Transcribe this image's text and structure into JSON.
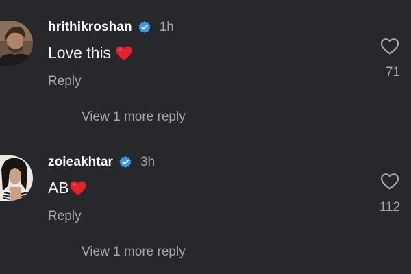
{
  "comments": [
    {
      "username": "hrithikroshan",
      "verified": true,
      "timestamp": "1h",
      "text": "Love this",
      "emoji": "red-heart",
      "reply_label": "Reply",
      "like_count": "71",
      "view_more_label": "View 1 more reply"
    },
    {
      "username": "zoieakhtar",
      "verified": true,
      "timestamp": "3h",
      "text": "AB",
      "emoji": "red-heart",
      "reply_label": "Reply",
      "like_count": "112",
      "view_more_label": "View 1 more reply"
    }
  ],
  "colors": {
    "background": "#26282c",
    "primary_text": "#f5f5f5",
    "secondary_text": "#a8a8a8",
    "verified_badge": "#3897f0",
    "heart": "#e8202e"
  }
}
